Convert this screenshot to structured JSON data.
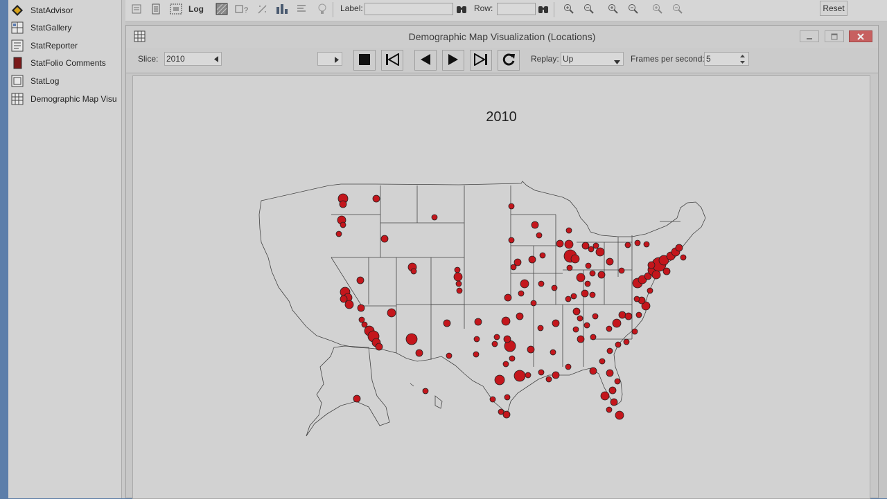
{
  "sidebar": {
    "items": [
      {
        "label": "StatAdvisor",
        "icon": "statadvisor-icon"
      },
      {
        "label": "StatGallery",
        "icon": "statgallery-icon"
      },
      {
        "label": "StatReporter",
        "icon": "statreporter-icon"
      },
      {
        "label": "StatFolio Comments",
        "icon": "comments-icon"
      },
      {
        "label": "StatLog",
        "icon": "statlog-icon"
      },
      {
        "label": "Demographic Map Visu",
        "icon": "map-visualization-icon"
      }
    ]
  },
  "toolbar": {
    "log_label": "Log",
    "label_field_label": "Label:",
    "label_field_value": "",
    "row_field_label": "Row:",
    "row_field_value": "",
    "reset_label": "Reset"
  },
  "window": {
    "title": "Demographic Map Visualization (Locations)",
    "slice_label": "Slice:",
    "slice_value": "2010",
    "replay_label": "Replay:",
    "replay_value": "Up",
    "fps_label": "Frames per second:",
    "fps_value": "5"
  },
  "chart_data": {
    "type": "map",
    "title": "2010",
    "marker_color": "#c4161c",
    "marker_stroke": "#222222"
  }
}
